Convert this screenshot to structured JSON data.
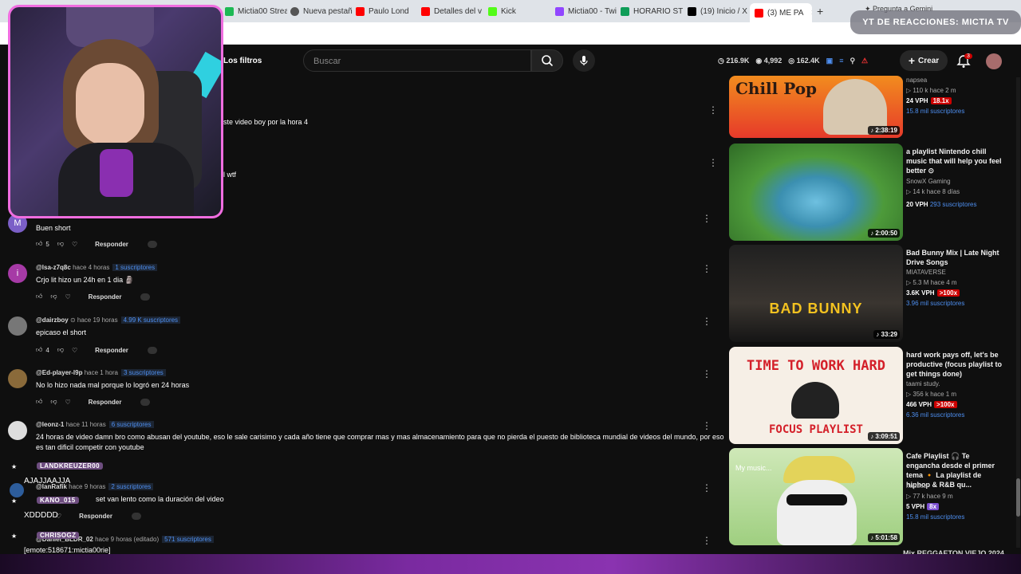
{
  "browser": {
    "tabs": [
      {
        "label": "Mictia00 Strea",
        "color": "#1db954"
      },
      {
        "label": "Nueva pestaña",
        "color": "#555555"
      },
      {
        "label": "Paulo Lond",
        "color": "#ff0000"
      },
      {
        "label": "Detalles del v",
        "color": "#ff0000"
      },
      {
        "label": "Kick",
        "color": "#53fc18"
      },
      {
        "label": "Mictia00 - Twi",
        "color": "#9146ff"
      },
      {
        "label": "HORARIO STR",
        "color": "#0f9d58"
      },
      {
        "label": "(19) Inicio / X",
        "color": "#000000"
      },
      {
        "label": "(3) ME PA",
        "color": "#ff0000"
      }
    ],
    "gemini": "Pregunta a Gemini"
  },
  "overlay": {
    "title": "YT DE REACCIONES: MICTIA TV"
  },
  "header": {
    "filters": "Los filtros",
    "search_placeholder": "Buscar",
    "stats": [
      "216.9K",
      "4,992",
      "162.4K"
    ],
    "create": "Crear",
    "notif_count": "3"
  },
  "partial_text": [
    "ste video boy por la hora 4",
    "l wtf"
  ],
  "comments": [
    {
      "avatar": "M",
      "avatar_color": "#7b5fc7",
      "user": "",
      "time": "",
      "subs": "",
      "text": "Buen short",
      "likes": "5"
    },
    {
      "avatar": "i",
      "avatar_color": "#a63aa6",
      "user": "@lsa-z7q8c",
      "time": "hace 4 horas",
      "subs": "1 suscriptores",
      "text": "Crjo lit hizo un 24h en 1 dia 🗿",
      "likes": ""
    },
    {
      "avatar": "",
      "avatar_color": "#777777",
      "user": "@dairzboy",
      "time": "hace 19 horas",
      "subs": "4.99 K suscriptores",
      "text": "epicaso el short",
      "likes": "4"
    },
    {
      "avatar": "",
      "avatar_color": "#8a6a3a",
      "user": "@Ed-player-l9p",
      "time": "hace 1 hora",
      "subs": "3 suscriptores",
      "text": "No lo hizo nada mal porque lo logró en 24 horas",
      "likes": ""
    },
    {
      "avatar": "",
      "avatar_color": "#dddddd",
      "user": "@leonz-1",
      "time": "hace 11 horas",
      "subs": "6 suscriptores",
      "text": "24 horas de video damn bro como abusan del youtube, eso le sale carisimo y cada año tiene que comprar mas y mas almacenamiento para que no pierda el puesto de biblioteca mundial de videos del mundo, por eso es tan dificil competir con youtube",
      "likes": ""
    },
    {
      "avatar": "",
      "avatar_color": "#2d5d9c",
      "user": "@lanRafik",
      "time": "hace 9 horas",
      "subs": "2 suscriptores",
      "text": "set van lento como la duración del video",
      "likes": ""
    },
    {
      "avatar": "",
      "avatar_color": "#444444",
      "user": "@Daniel_BLDR_02",
      "time": "hace 9 horas (editado)",
      "subs": "571 suscriptores",
      "text": "",
      "likes": ""
    }
  ],
  "reply_label": "Responder",
  "chat": [
    {
      "user": "LANDKREUZER00",
      "msg": "AJAJJAAJJA"
    },
    {
      "user": "KANO_015",
      "msg": "XDDDDD"
    },
    {
      "user": "CHRISOGZ",
      "msg": "[emote:518671:mictia00rie]"
    }
  ],
  "videos": [
    {
      "title": "",
      "channel": "napsea",
      "views": "110 k",
      "ago": "hace 2 m",
      "vph": "24 VPH",
      "mult": "18.1x",
      "subs": "15.8 mil suscriptores",
      "duration": "2:38:19",
      "thumb_text": "Chill Pop",
      "thumb_bg": "#e63a2a"
    },
    {
      "title": "a playlist Nintendo chill music that will help you feel better ⊙",
      "channel": "SnowX Gaming",
      "views": "14 k",
      "ago": "hace 8 días",
      "vph": "20 VPH",
      "mult": "",
      "subs": "293 suscriptores",
      "duration": "2:00:50",
      "thumb_text": "",
      "thumb_bg": "#4d9a3a"
    },
    {
      "title": "Bad Bunny Mix | Late Night Drive Songs",
      "channel": "MIATAVERSE",
      "views": "5.3 M",
      "ago": "hace 4 m",
      "vph": "3.6K VPH",
      "mult": ">100x",
      "subs": "3.96 mil suscriptores",
      "duration": "33:29",
      "thumb_text": "BAD BUNNY",
      "thumb_bg": "#1a1a18"
    },
    {
      "title": "hard work pays off, let's be productive (focus playlist to get things done)",
      "channel": "taami study.",
      "views": "356 k",
      "ago": "hace 1 m",
      "vph": "466 VPH",
      "mult": ">100x",
      "subs": "6.36 mil suscriptores",
      "duration": "3:09:51",
      "thumb_text": "TIME TO WORK HARD",
      "thumb_text2": "FOCUS PLAYLIST",
      "thumb_bg": "#f6efe6"
    },
    {
      "title": "Cafe Playlist 🎧 Te engancha desde el primer tema 🔸 La playlist de hiphop & R&B qu...",
      "channel": "napsea",
      "views": "77 k",
      "ago": "hace 9 m",
      "vph": "5 VPH",
      "mult": "8x",
      "subs": "15.8 mil suscriptores",
      "duration": "5:01:58",
      "thumb_text": "My music...",
      "thumb_bg": "#bfe3a0"
    }
  ]
}
